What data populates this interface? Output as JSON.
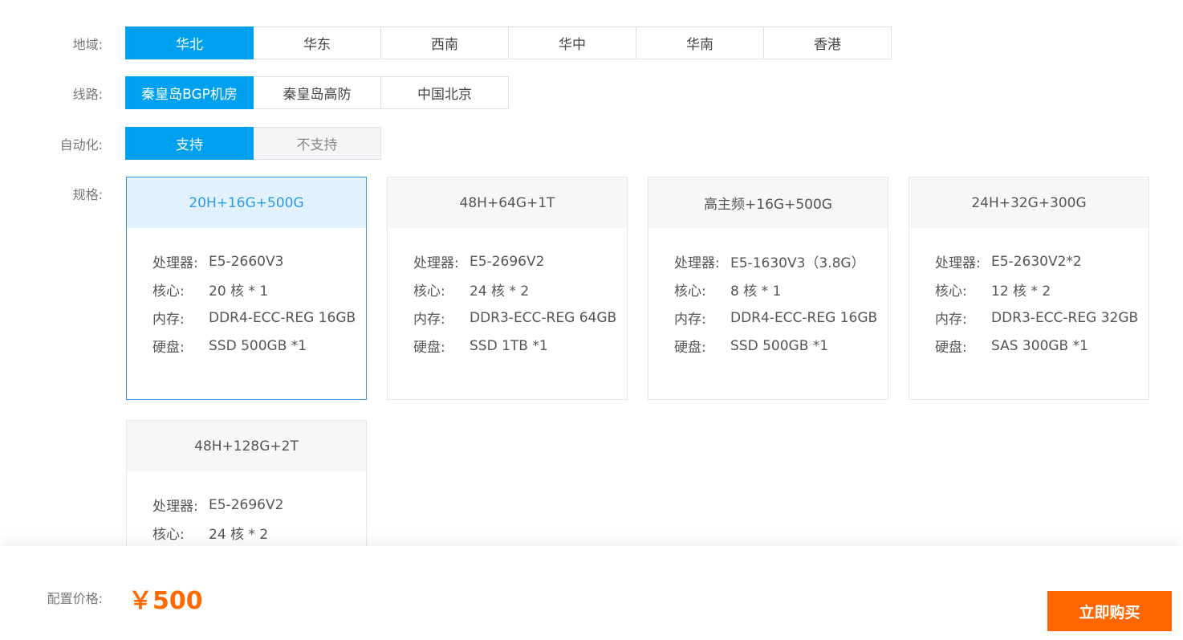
{
  "region": {
    "label": "地域:",
    "options": [
      "华北",
      "华东",
      "西南",
      "华中",
      "华南",
      "香港"
    ],
    "selected": 0
  },
  "line": {
    "label": "线路:",
    "options": [
      "秦皇岛BGP机房",
      "秦皇岛高防",
      "中国北京"
    ],
    "selected": 0
  },
  "automation": {
    "label": "自动化:",
    "options": [
      "支持",
      "不支持"
    ],
    "selected": 0
  },
  "specs": {
    "label": "规格:",
    "field_labels": {
      "cpu": "处理器:",
      "cores": "核心:",
      "memory": "内存:",
      "disk": "硬盘:"
    },
    "cards": [
      {
        "title": "20H+16G+500G",
        "cpu": "E5-2660V3",
        "cores": "20 核 * 1",
        "memory": "DDR4-ECC-REG 16GB",
        "disk": "SSD 500GB *1",
        "selected": true
      },
      {
        "title": "48H+64G+1T",
        "cpu": "E5-2696V2",
        "cores": "24 核 * 2",
        "memory": "DDR3-ECC-REG 64GB",
        "disk": "SSD 1TB *1",
        "selected": false
      },
      {
        "title": "高主频+16G+500G",
        "cpu": "E5-1630V3（3.8G）",
        "cores": "8 核 * 1",
        "memory": "DDR4-ECC-REG 16GB",
        "disk": "SSD 500GB *1",
        "selected": false
      },
      {
        "title": "24H+32G+300G",
        "cpu": "E5-2630V2*2",
        "cores": "12 核 * 2",
        "memory": "DDR3-ECC-REG 32GB",
        "disk": "SAS 300GB *1",
        "selected": false
      },
      {
        "title": "48H+128G+2T",
        "cpu": "E5-2696V2",
        "cores": "24 核 * 2",
        "memory": "",
        "disk": "",
        "selected": false
      }
    ]
  },
  "footer": {
    "price_label": "配置价格:",
    "price_value": "￥500",
    "buy_label": "立即购买"
  },
  "colors": {
    "accent": "#00a0f0",
    "price": "#ff6a00",
    "buy_button": "#ff6600"
  }
}
